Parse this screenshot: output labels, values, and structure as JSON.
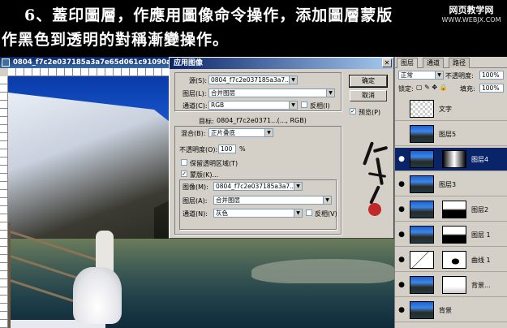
{
  "caption": {
    "line1": "6、蓋印圖層，作應用圖像命令操作，添加圖層蒙版",
    "line2": "作黑色到透明的對稱漸變操作。"
  },
  "watermark": {
    "line1": "网页教学网",
    "line2": "WWW.WEBJX.COM"
  },
  "document": {
    "title": "0804_f7c2e037185a3a7e65d061c91090acb7"
  },
  "apply_image": {
    "title": "应用图像",
    "source_label": "源(S):",
    "source_value": "0804_f7c2e037185a3a7...",
    "layer_label": "图层(L):",
    "layer_value": "合并图层",
    "channel_label": "通道(C):",
    "channel_value": "RGB",
    "invert_label": "反相(I)",
    "target_label": "目标:",
    "target_value": "0804_f7c2e0371...(..., RGB)",
    "blending_label": "混合(B):",
    "blending_value": "正片叠底",
    "opacity_label": "不透明度(O):",
    "opacity_value": "100",
    "opacity_unit": "%",
    "preserve_label": "保留透明区域(T)",
    "mask_label": "蒙版(K)...",
    "mask_image_label": "图像(M):",
    "mask_image_value": "0804_f7c2e037185a3a7...",
    "mask_layer_label": "图层(A):",
    "mask_layer_value": "合并图层",
    "mask_channel_label": "通道(N):",
    "mask_channel_value": "灰色",
    "mask_invert_label": "反相(V)",
    "ok_label": "确定",
    "cancel_label": "取消",
    "preview_label": "预览(P)"
  },
  "layers_panel": {
    "tabs": [
      "图层",
      "通道",
      "路径"
    ],
    "blend_mode": "正常",
    "opacity_label": "不透明度:",
    "opacity_value": "100%",
    "lock_label": "锁定:",
    "fill_label": "填充:",
    "fill_value": "100%",
    "layers": [
      {
        "name": "文字",
        "visible": false,
        "selected": false,
        "thumb": "checker",
        "mask": null
      },
      {
        "name": "图层5",
        "visible": false,
        "selected": false,
        "thumb": "photo",
        "mask": null
      },
      {
        "name": "图层4",
        "visible": true,
        "selected": true,
        "thumb": "photo",
        "mask": "gradient"
      },
      {
        "name": "图层3",
        "visible": true,
        "selected": false,
        "thumb": "photo",
        "mask": null
      },
      {
        "name": "图层2",
        "visible": true,
        "selected": false,
        "thumb": "photo",
        "mask": "dark-bottom"
      },
      {
        "name": "图层 1",
        "visible": true,
        "selected": false,
        "thumb": "photo",
        "mask": "dark-bottom"
      },
      {
        "name": "曲线 1",
        "visible": true,
        "selected": false,
        "thumb": "curves",
        "mask": "figure"
      },
      {
        "name": "背景...",
        "visible": true,
        "selected": false,
        "thumb": "photo",
        "mask": "white-mask"
      },
      {
        "name": "背景",
        "visible": true,
        "selected": false,
        "thumb": "photo",
        "mask": null
      }
    ]
  }
}
